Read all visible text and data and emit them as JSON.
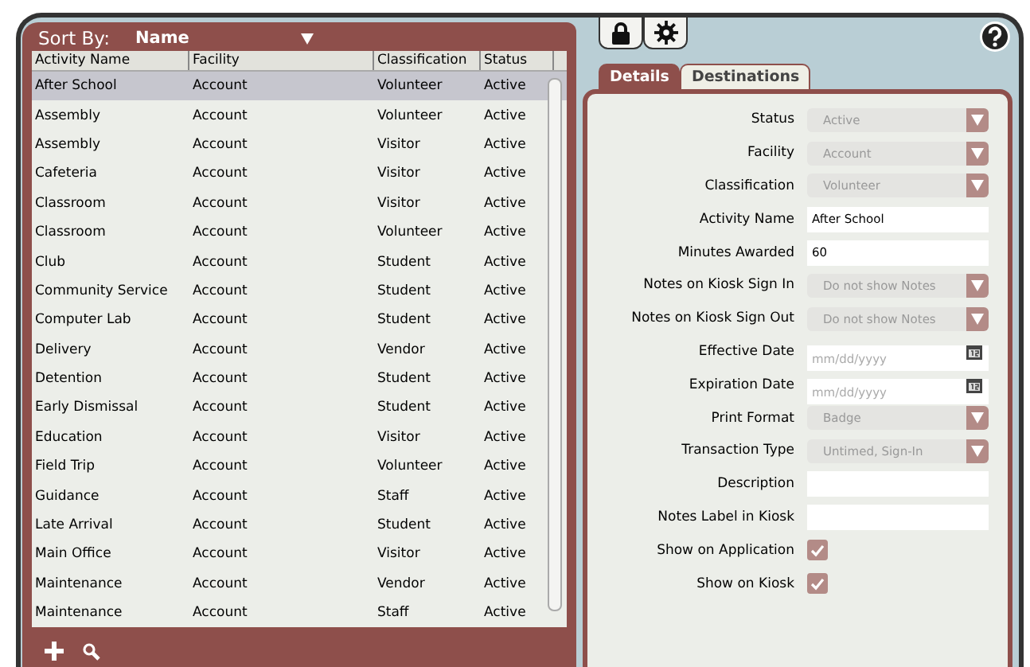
{
  "sort": {
    "label": "Sort By:",
    "value": "Name"
  },
  "table": {
    "columns": [
      "Activity Name",
      "Facility",
      "Classification",
      "Status"
    ],
    "rows": [
      {
        "cells": [
          "After School",
          "Account",
          "Volunteer",
          "Active"
        ],
        "selected": true
      },
      {
        "cells": [
          "Assembly",
          "Account",
          "Volunteer",
          "Active"
        ],
        "selected": false
      },
      {
        "cells": [
          "Assembly",
          "Account",
          "Visitor",
          "Active"
        ],
        "selected": false
      },
      {
        "cells": [
          "Cafeteria",
          "Account",
          "Visitor",
          "Active"
        ],
        "selected": false
      },
      {
        "cells": [
          "Classroom",
          "Account",
          "Visitor",
          "Active"
        ],
        "selected": false
      },
      {
        "cells": [
          "Classroom",
          "Account",
          "Volunteer",
          "Active"
        ],
        "selected": false
      },
      {
        "cells": [
          "Club",
          "Account",
          "Student",
          "Active"
        ],
        "selected": false
      },
      {
        "cells": [
          "Community Service",
          "Account",
          "Student",
          "Active"
        ],
        "selected": false
      },
      {
        "cells": [
          "Computer Lab",
          "Account",
          "Student",
          "Active"
        ],
        "selected": false
      },
      {
        "cells": [
          "Delivery",
          "Account",
          "Vendor",
          "Active"
        ],
        "selected": false
      },
      {
        "cells": [
          "Detention",
          "Account",
          "Student",
          "Active"
        ],
        "selected": false
      },
      {
        "cells": [
          "Early Dismissal",
          "Account",
          "Student",
          "Active"
        ],
        "selected": false
      },
      {
        "cells": [
          "Education",
          "Account",
          "Visitor",
          "Active"
        ],
        "selected": false
      },
      {
        "cells": [
          "Field Trip",
          "Account",
          "Volunteer",
          "Active"
        ],
        "selected": false
      },
      {
        "cells": [
          "Guidance",
          "Account",
          "Staff",
          "Active"
        ],
        "selected": false
      },
      {
        "cells": [
          "Late Arrival",
          "Account",
          "Student",
          "Active"
        ],
        "selected": false
      },
      {
        "cells": [
          "Main Office",
          "Account",
          "Visitor",
          "Active"
        ],
        "selected": false
      },
      {
        "cells": [
          "Maintenance",
          "Account",
          "Vendor",
          "Active"
        ],
        "selected": false
      },
      {
        "cells": [
          "Maintenance",
          "Account",
          "Staff",
          "Active"
        ],
        "selected": false
      }
    ]
  },
  "tabs": [
    {
      "label": "Details",
      "selected": true
    },
    {
      "label": "Destinations",
      "selected": false
    }
  ],
  "form": [
    {
      "kind": "select",
      "label": "Status",
      "value": "Active"
    },
    {
      "kind": "select",
      "label": "Facility",
      "value": "Account"
    },
    {
      "kind": "select",
      "label": "Classification",
      "value": "Volunteer"
    },
    {
      "kind": "text",
      "label": "Activity Name",
      "value": "After School"
    },
    {
      "kind": "text",
      "label": "Minutes Awarded",
      "value": "60"
    },
    {
      "kind": "select",
      "label": "Notes on Kiosk Sign In",
      "value": "Do not show Notes"
    },
    {
      "kind": "select",
      "label": "Notes on Kiosk Sign Out",
      "value": "Do not show Notes"
    },
    {
      "kind": "date",
      "label": "Effective Date",
      "placeholder": "mm/dd/yyyy"
    },
    {
      "kind": "date",
      "label": "Expiration Date",
      "placeholder": "mm/dd/yyyy"
    },
    {
      "kind": "select",
      "label": "Print Format",
      "value": "Badge"
    },
    {
      "kind": "select",
      "label": "Transaction Type",
      "value": "Untimed, Sign-In"
    },
    {
      "kind": "text",
      "label": "Description"
    },
    {
      "kind": "text",
      "label": "Notes Label in Kiosk"
    },
    {
      "kind": "checkbox",
      "label": "Show on Application",
      "checked": true
    },
    {
      "kind": "checkbox",
      "label": "Show on Kiosk",
      "checked": true
    }
  ]
}
